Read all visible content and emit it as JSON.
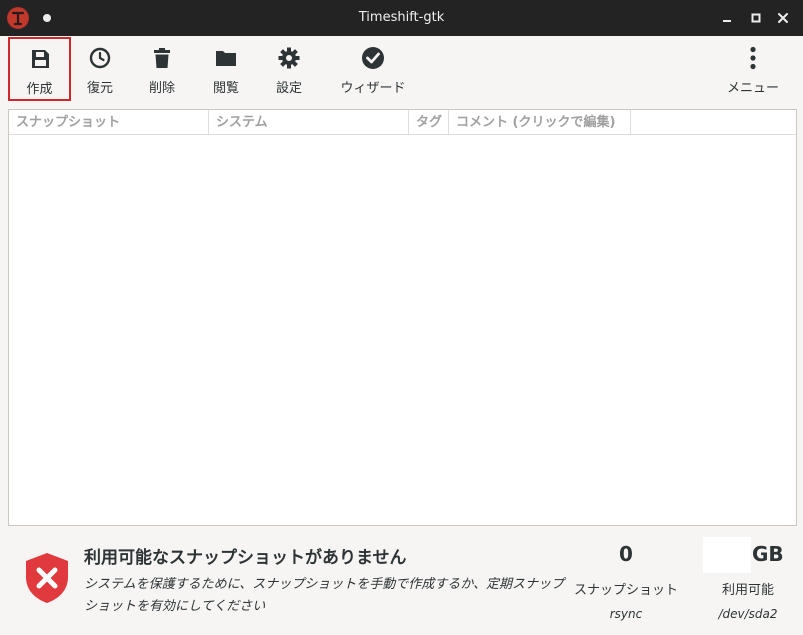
{
  "window": {
    "title": "Timeshift-gtk"
  },
  "toolbar": {
    "create": "作成",
    "restore": "復元",
    "delete": "削除",
    "browse": "閲覧",
    "settings": "設定",
    "wizard": "ウィザード",
    "menu": "メニュー"
  },
  "table": {
    "columns": [
      "スナップショット",
      "システム",
      "タグ",
      "コメント (クリックで編集)"
    ],
    "rows": []
  },
  "status": {
    "title": "利用可能なスナップショットがありません",
    "message": "システムを保護するために、スナップショットを手動で作成するか、定期スナップショットを有効にしてください",
    "snapshot_count": "0",
    "snapshot_label": "スナップショット",
    "mode": "rsync",
    "space_value": "",
    "space_unit": "GB",
    "space_label": "利用可能",
    "device": "/dev/sda2"
  },
  "colors": {
    "titlebar": "#232323",
    "window_bg": "#f6f5f4",
    "active_outline": "#d02828",
    "error_shield": "#e0393e"
  }
}
